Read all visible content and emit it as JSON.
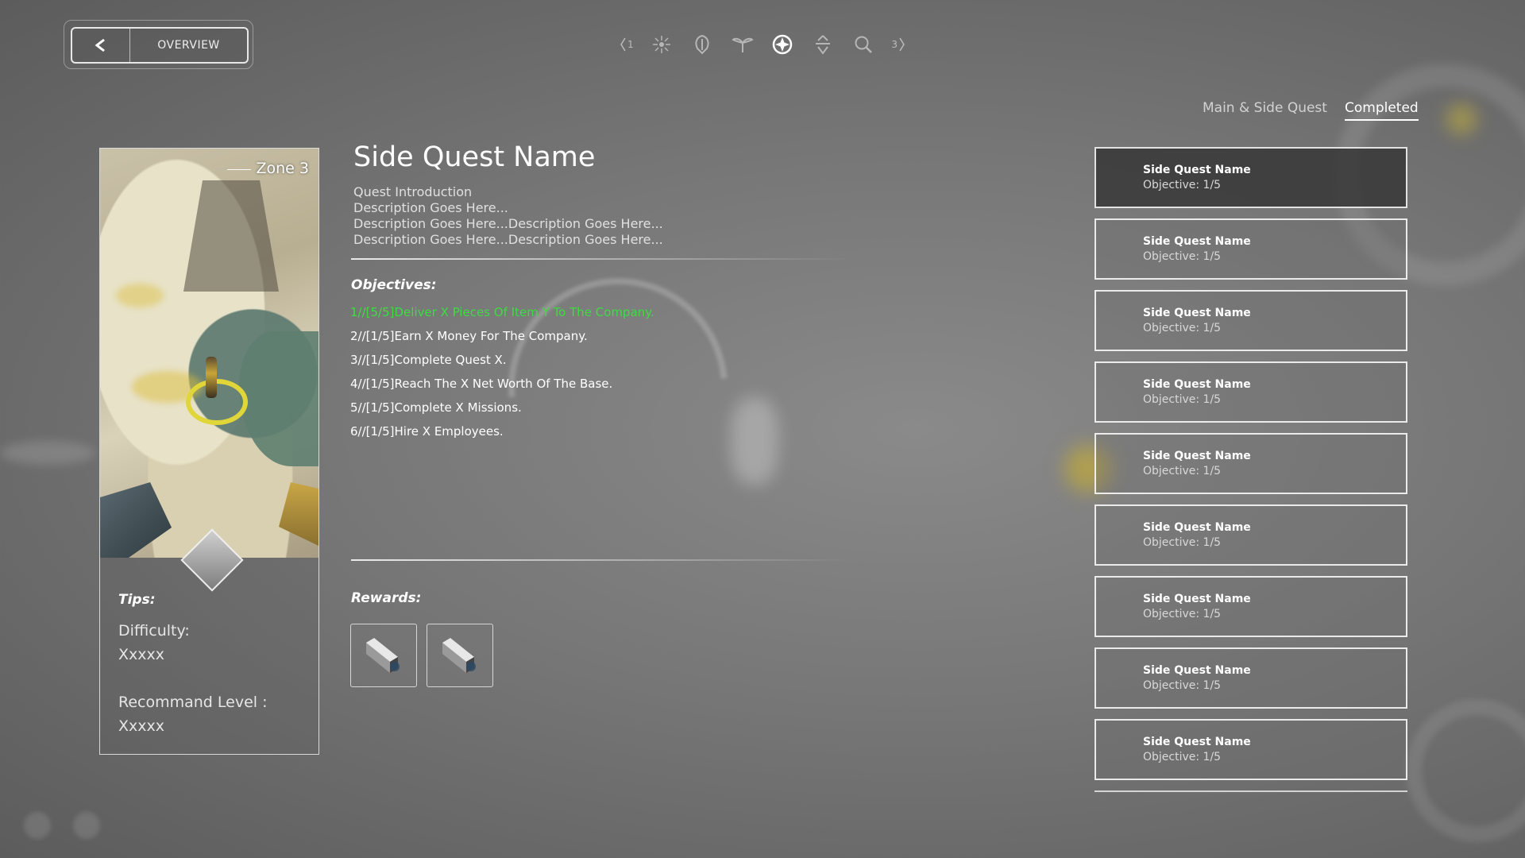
{
  "header": {
    "overview_label": "OVERVIEW",
    "prev_page": "1",
    "next_page": "3",
    "categories": [
      {
        "icon": "sparkle-icon"
      },
      {
        "icon": "shield-leaf-icon"
      },
      {
        "icon": "sprout-icon"
      },
      {
        "icon": "compass-star-icon",
        "active": true
      },
      {
        "icon": "arrows-icon"
      },
      {
        "icon": "magnifier-icon"
      }
    ]
  },
  "tabs": {
    "main_side": "Main & Side Quest",
    "completed": "Completed"
  },
  "card": {
    "zone": "Zone 3",
    "tips_title": "Tips:",
    "difficulty_label": "Difficulty:",
    "difficulty_value": "Xxxxx",
    "level_label": "Recommand Level :",
    "level_value": "Xxxxx"
  },
  "quest": {
    "title": "Side Quest Name",
    "intro_lines": [
      "Quest Introduction",
      "Description Goes Here...",
      "Description Goes Here...Description Goes Here...",
      "Description Goes Here...Description Goes Here..."
    ],
    "objectives_title": "Objectives:",
    "objectives": [
      "1//[5/5]Deliver X Pieces Of Item Y To The Company.",
      "2//[1/5]Earn X Money For The Company.",
      "3//[1/5]Complete Quest X.",
      "4//[1/5]Reach The X Net Worth Of The Base.",
      "5//[1/5]Complete X Missions.",
      "6//[1/5]Hire X Employees."
    ],
    "rewards_title": "Rewards:"
  },
  "quest_list": [
    {
      "name": "Side Quest Name",
      "objective": "Objective: 1/5"
    },
    {
      "name": "Side Quest Name",
      "objective": "Objective: 1/5"
    },
    {
      "name": "Side Quest Name",
      "objective": "Objective: 1/5"
    },
    {
      "name": "Side Quest Name",
      "objective": "Objective: 1/5"
    },
    {
      "name": "Side Quest Name",
      "objective": "Objective: 1/5"
    },
    {
      "name": "Side Quest Name",
      "objective": "Objective: 1/5"
    },
    {
      "name": "Side Quest Name",
      "objective": "Objective: 1/5"
    },
    {
      "name": "Side Quest Name",
      "objective": "Objective: 1/5"
    },
    {
      "name": "Side Quest Name",
      "objective": "Objective: 1/5"
    }
  ],
  "colors": {
    "completed_objective": "#3ddc43",
    "selected_item_bg": "#373737"
  }
}
